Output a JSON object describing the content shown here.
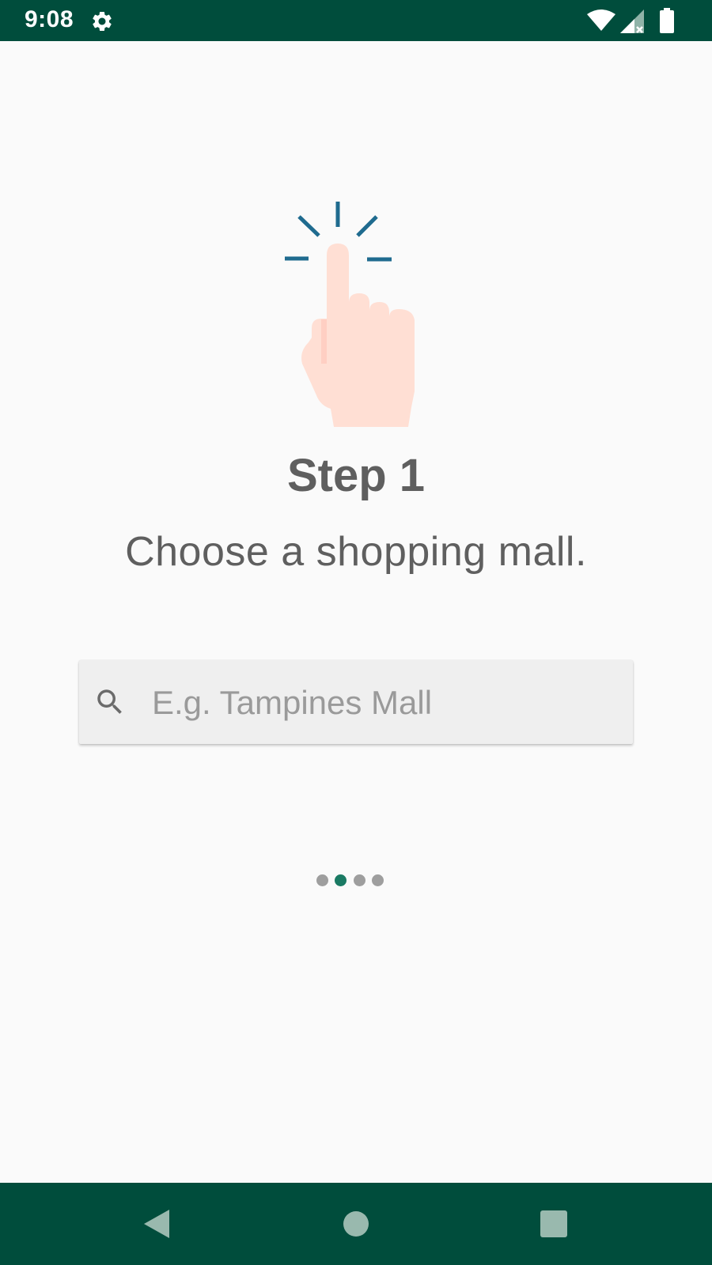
{
  "status_bar": {
    "time": "9:08",
    "icons": [
      "gear-icon",
      "wifi-icon",
      "signal-icon",
      "battery-icon"
    ]
  },
  "onboarding": {
    "illustration": "pointing-hand-icon",
    "title": "Step 1",
    "subtitle": "Choose a shopping mall."
  },
  "search": {
    "icon": "search-icon",
    "value": "",
    "placeholder": "E.g. Tampines Mall"
  },
  "pager": {
    "count": 4,
    "active_index": 1
  },
  "navigation_bar": {
    "buttons": [
      "back-icon",
      "home-icon",
      "recents-icon"
    ]
  },
  "colors": {
    "status_bar": "#004d3c",
    "accent": "#1a7a63",
    "tap_lines": "#1f6b8f",
    "hand": "#ffdfd4",
    "text": "#5f5f5f"
  }
}
